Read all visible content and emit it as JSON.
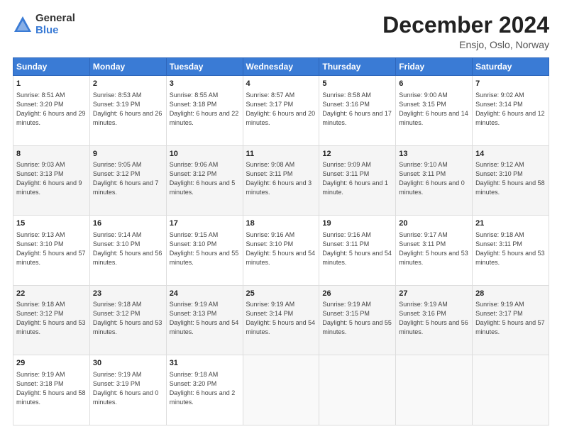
{
  "logo": {
    "general": "General",
    "blue": "Blue"
  },
  "header": {
    "title": "December 2024",
    "subtitle": "Ensjo, Oslo, Norway"
  },
  "calendar": {
    "days_of_week": [
      "Sunday",
      "Monday",
      "Tuesday",
      "Wednesday",
      "Thursday",
      "Friday",
      "Saturday"
    ],
    "weeks": [
      [
        {
          "day": "1",
          "sunrise": "8:51 AM",
          "sunset": "3:20 PM",
          "daylight": "6 hours and 29 minutes."
        },
        {
          "day": "2",
          "sunrise": "8:53 AM",
          "sunset": "3:19 PM",
          "daylight": "6 hours and 26 minutes."
        },
        {
          "day": "3",
          "sunrise": "8:55 AM",
          "sunset": "3:18 PM",
          "daylight": "6 hours and 22 minutes."
        },
        {
          "day": "4",
          "sunrise": "8:57 AM",
          "sunset": "3:17 PM",
          "daylight": "6 hours and 20 minutes."
        },
        {
          "day": "5",
          "sunrise": "8:58 AM",
          "sunset": "3:16 PM",
          "daylight": "6 hours and 17 minutes."
        },
        {
          "day": "6",
          "sunrise": "9:00 AM",
          "sunset": "3:15 PM",
          "daylight": "6 hours and 14 minutes."
        },
        {
          "day": "7",
          "sunrise": "9:02 AM",
          "sunset": "3:14 PM",
          "daylight": "6 hours and 12 minutes."
        }
      ],
      [
        {
          "day": "8",
          "sunrise": "9:03 AM",
          "sunset": "3:13 PM",
          "daylight": "6 hours and 9 minutes."
        },
        {
          "day": "9",
          "sunrise": "9:05 AM",
          "sunset": "3:12 PM",
          "daylight": "6 hours and 7 minutes."
        },
        {
          "day": "10",
          "sunrise": "9:06 AM",
          "sunset": "3:12 PM",
          "daylight": "6 hours and 5 minutes."
        },
        {
          "day": "11",
          "sunrise": "9:08 AM",
          "sunset": "3:11 PM",
          "daylight": "6 hours and 3 minutes."
        },
        {
          "day": "12",
          "sunrise": "9:09 AM",
          "sunset": "3:11 PM",
          "daylight": "6 hours and 1 minute."
        },
        {
          "day": "13",
          "sunrise": "9:10 AM",
          "sunset": "3:11 PM",
          "daylight": "6 hours and 0 minutes."
        },
        {
          "day": "14",
          "sunrise": "9:12 AM",
          "sunset": "3:10 PM",
          "daylight": "5 hours and 58 minutes."
        }
      ],
      [
        {
          "day": "15",
          "sunrise": "9:13 AM",
          "sunset": "3:10 PM",
          "daylight": "5 hours and 57 minutes."
        },
        {
          "day": "16",
          "sunrise": "9:14 AM",
          "sunset": "3:10 PM",
          "daylight": "5 hours and 56 minutes."
        },
        {
          "day": "17",
          "sunrise": "9:15 AM",
          "sunset": "3:10 PM",
          "daylight": "5 hours and 55 minutes."
        },
        {
          "day": "18",
          "sunrise": "9:16 AM",
          "sunset": "3:10 PM",
          "daylight": "5 hours and 54 minutes."
        },
        {
          "day": "19",
          "sunrise": "9:16 AM",
          "sunset": "3:11 PM",
          "daylight": "5 hours and 54 minutes."
        },
        {
          "day": "20",
          "sunrise": "9:17 AM",
          "sunset": "3:11 PM",
          "daylight": "5 hours and 53 minutes."
        },
        {
          "day": "21",
          "sunrise": "9:18 AM",
          "sunset": "3:11 PM",
          "daylight": "5 hours and 53 minutes."
        }
      ],
      [
        {
          "day": "22",
          "sunrise": "9:18 AM",
          "sunset": "3:12 PM",
          "daylight": "5 hours and 53 minutes."
        },
        {
          "day": "23",
          "sunrise": "9:18 AM",
          "sunset": "3:12 PM",
          "daylight": "5 hours and 53 minutes."
        },
        {
          "day": "24",
          "sunrise": "9:19 AM",
          "sunset": "3:13 PM",
          "daylight": "5 hours and 54 minutes."
        },
        {
          "day": "25",
          "sunrise": "9:19 AM",
          "sunset": "3:14 PM",
          "daylight": "5 hours and 54 minutes."
        },
        {
          "day": "26",
          "sunrise": "9:19 AM",
          "sunset": "3:15 PM",
          "daylight": "5 hours and 55 minutes."
        },
        {
          "day": "27",
          "sunrise": "9:19 AM",
          "sunset": "3:16 PM",
          "daylight": "5 hours and 56 minutes."
        },
        {
          "day": "28",
          "sunrise": "9:19 AM",
          "sunset": "3:17 PM",
          "daylight": "5 hours and 57 minutes."
        }
      ],
      [
        {
          "day": "29",
          "sunrise": "9:19 AM",
          "sunset": "3:18 PM",
          "daylight": "5 hours and 58 minutes."
        },
        {
          "day": "30",
          "sunrise": "9:19 AM",
          "sunset": "3:19 PM",
          "daylight": "6 hours and 0 minutes."
        },
        {
          "day": "31",
          "sunrise": "9:18 AM",
          "sunset": "3:20 PM",
          "daylight": "6 hours and 2 minutes."
        },
        null,
        null,
        null,
        null
      ]
    ]
  }
}
